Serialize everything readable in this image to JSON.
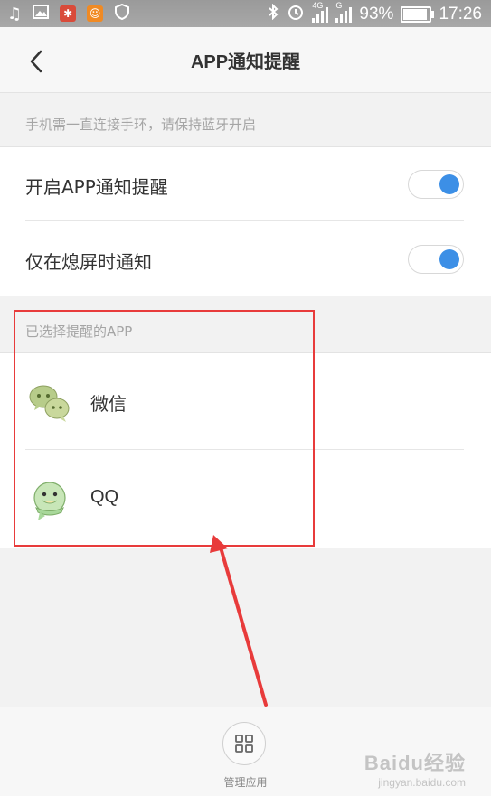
{
  "status_bar": {
    "battery_text": "93%",
    "battery_level": 0.93,
    "time": "17:26",
    "network_4g": "4G",
    "network_g": "G"
  },
  "header": {
    "title": "APP通知提醒",
    "back_icon": "chevron-left-icon"
  },
  "hint": "手机需一直连接手环，请保持蓝牙开启",
  "settings": [
    {
      "label": "开启APP通知提醒",
      "enabled": true
    },
    {
      "label": "仅在熄屏时通知",
      "enabled": true
    }
  ],
  "selected_apps": {
    "title": "已选择提醒的APP",
    "items": [
      {
        "label": "微信",
        "icon": "wechat-icon"
      },
      {
        "label": "QQ",
        "icon": "qq-icon"
      }
    ]
  },
  "bottom": {
    "manage_label": "管理应用",
    "manage_icon": "grid-icon"
  },
  "watermark": {
    "main": "Baidu经验",
    "sub": "jingyan.baidu.com"
  },
  "colors": {
    "accent": "#3c8fe6",
    "annotation": "#e83b3b",
    "hint_text": "#a5a5a5"
  }
}
